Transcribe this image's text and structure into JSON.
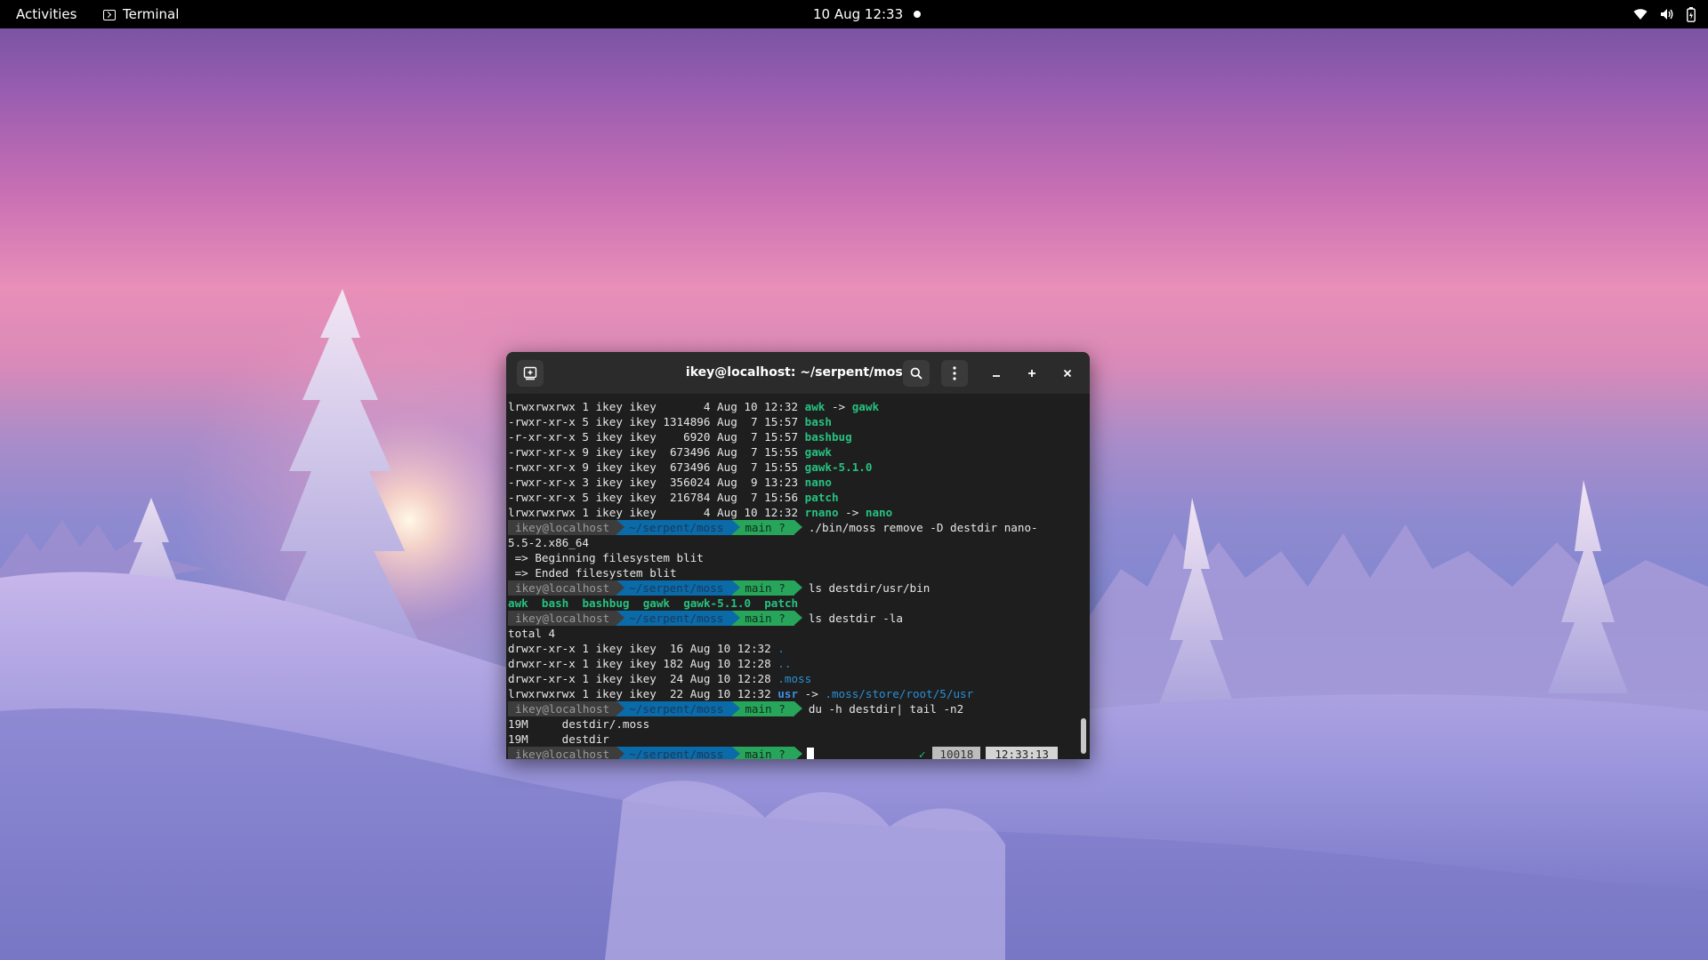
{
  "topbar": {
    "activities": "Activities",
    "app_name": "Terminal",
    "clock": "10 Aug  12:33"
  },
  "window": {
    "title": "ikey@localhost: ~/serpent/moss"
  },
  "prompt": {
    "host": "ikey@localhost",
    "path": "~/serpent/moss",
    "git": "main ?"
  },
  "listing1": [
    {
      "meta": "lrwxrwxrwx 1 ikey ikey       4 Aug 10 12:32 ",
      "name": "awk",
      "arrow": " -> ",
      "target": "gawk"
    },
    {
      "meta": "-rwxr-xr-x 5 ikey ikey 1314896 Aug  7 15:57 ",
      "name": "bash"
    },
    {
      "meta": "-r-xr-xr-x 5 ikey ikey    6920 Aug  7 15:57 ",
      "name": "bashbug"
    },
    {
      "meta": "-rwxr-xr-x 9 ikey ikey  673496 Aug  7 15:55 ",
      "name": "gawk"
    },
    {
      "meta": "-rwxr-xr-x 9 ikey ikey  673496 Aug  7 15:55 ",
      "name": "gawk-5.1.0"
    },
    {
      "meta": "-rwxr-xr-x 3 ikey ikey  356024 Aug  9 13:23 ",
      "name": "nano"
    },
    {
      "meta": "-rwxr-xr-x 5 ikey ikey  216784 Aug  7 15:56 ",
      "name": "patch"
    },
    {
      "meta": "lrwxrwxrwx 1 ikey ikey       4 Aug 10 12:32 ",
      "name": "rnano",
      "arrow": " -> ",
      "target": "nano"
    }
  ],
  "cmd1": "./bin/moss remove -D destdir nano-",
  "cmd1_wrap": "5.5-2.x86_64",
  "blit_begin": " => Beginning filesystem blit",
  "blit_end": " => Ended filesystem blit",
  "cmd2": "ls destdir/usr/bin",
  "bin_names": [
    "awk",
    "bash",
    "bashbug",
    "gawk",
    "gawk-5.1.0",
    "patch"
  ],
  "cmd3": "ls destdir -la",
  "total": "total 4",
  "listing2": [
    {
      "meta": "drwxr-xr-x 1 ikey ikey  16 Aug 10 12:32 ",
      "name": "."
    },
    {
      "meta": "drwxr-xr-x 1 ikey ikey 182 Aug 10 12:28 ",
      "name": ".."
    },
    {
      "meta": "drwxr-xr-x 1 ikey ikey  24 Aug 10 12:28 ",
      "name": ".moss"
    },
    {
      "meta": "lrwxrwxrwx 1 ikey ikey  22 Aug 10 12:32 ",
      "name": "usr",
      "arrow": " -> ",
      "target": ".moss/store/root/5/usr"
    }
  ],
  "cmd4": "du -h destdir| tail -n2",
  "du1": "19M     destdir/.moss",
  "du2": "19M     destdir",
  "right_prompt": {
    "status": "✓",
    "jobs": "10018",
    "time": "12:33:13"
  }
}
